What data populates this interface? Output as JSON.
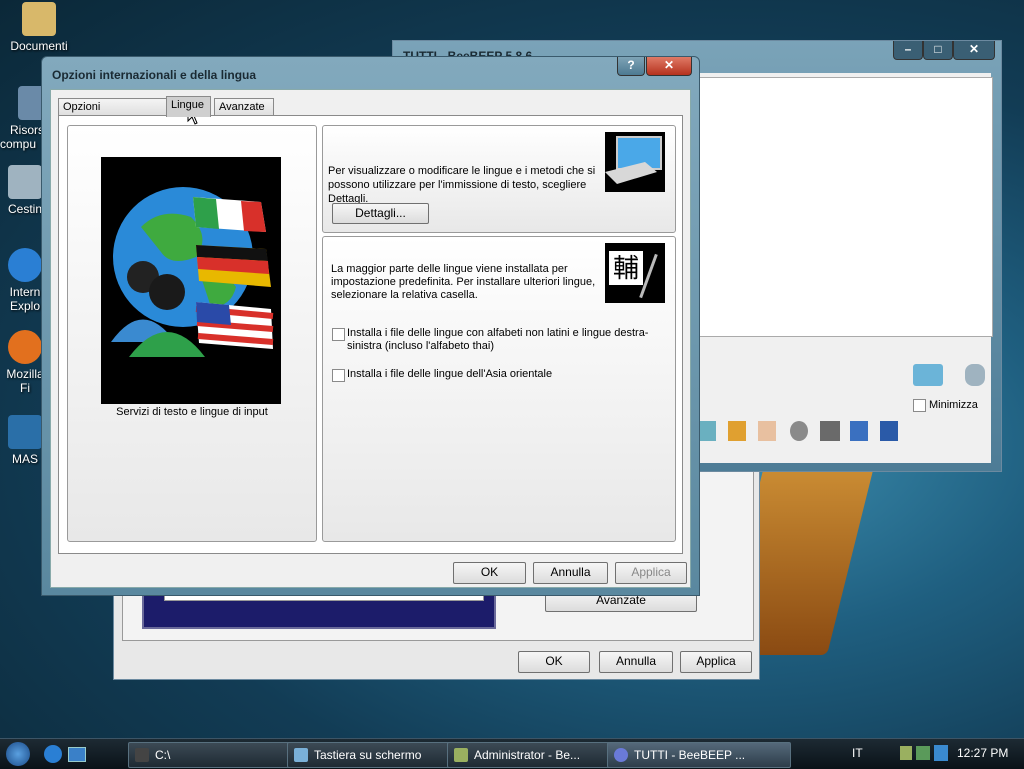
{
  "desktop": {
    "icons": [
      {
        "label": "Documenti"
      },
      {
        "label": "Risorse compu"
      },
      {
        "label": "Cestin"
      },
      {
        "label": "Intern Explo"
      },
      {
        "label": "Mozilla Fi"
      },
      {
        "label": "MAS"
      }
    ]
  },
  "beebeep_window": {
    "title": "TUTTI - BeeBEEP 5.8.6",
    "minimize_label": "Minimizza",
    "close_glyph": "✕"
  },
  "keyboard_dialog": {
    "advanced_label": "Avanzate",
    "ok_label": "OK",
    "cancel_label": "Annulla",
    "apply_label": "Applica"
  },
  "dialog": {
    "title": "Opzioni internazionali e della lingua",
    "help_glyph": "?",
    "close_glyph": "✕",
    "tabs": [
      {
        "label": "Opzioni internazionali"
      },
      {
        "label": "Lingue"
      },
      {
        "label": "Avanzate"
      }
    ],
    "left_caption": "Servizi di testo e lingue di input",
    "group1_text": "Per visualizzare o modificare le lingue e i metodi che si possono utilizzare per l'immissione di testo, scegliere Dettagli.",
    "details_label": "Dettagli...",
    "group2_text": "La maggior parte delle lingue viene installata per impostazione predefinita. Per installare ulteriori lingue, selezionare la relativa casella.",
    "ime_glyph": "輔",
    "checkbox1_label": "Installa i file delle lingue con alfabeti non latini e lingue destra-sinistra (incluso l'alfabeto thai)",
    "checkbox2_label": "Installa i file delle lingue dell'Asia orientale",
    "ok_label": "OK",
    "cancel_label": "Annulla",
    "apply_label": "Applica"
  },
  "taskbar": {
    "items": [
      {
        "label": "C:\\"
      },
      {
        "label": "Tastiera su schermo"
      },
      {
        "label": "Administrator - Be..."
      },
      {
        "label": "TUTTI - BeeBEEP ..."
      }
    ],
    "lang": "IT",
    "clock": "12:27 PM"
  },
  "colors": {
    "close_red": "#c8402e",
    "desktop_dark": "#0b2838"
  }
}
